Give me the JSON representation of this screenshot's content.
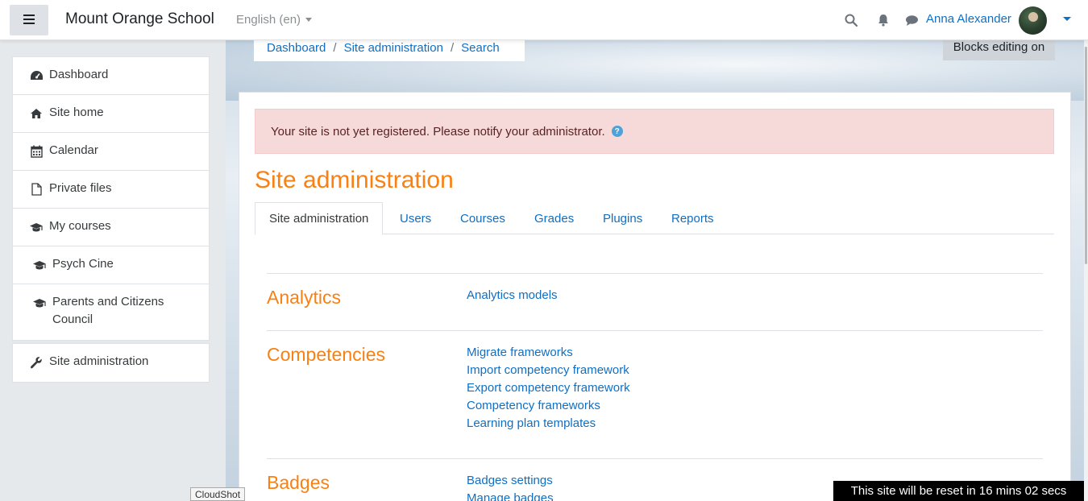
{
  "header": {
    "brand": "Mount Orange School",
    "language": "English (en)",
    "user_name": "Anna Alexander"
  },
  "icons": {
    "menu": "hamburger-icon",
    "search": "search-icon",
    "notifications": "bell-icon",
    "messages": "chat-icon"
  },
  "sidebar": {
    "items": [
      {
        "label": "Dashboard",
        "icon": "dashboard-icon"
      },
      {
        "label": "Site home",
        "icon": "home-icon"
      },
      {
        "label": "Calendar",
        "icon": "calendar-icon"
      },
      {
        "label": "Private files",
        "icon": "file-icon"
      },
      {
        "label": "My courses",
        "icon": "graduation-cap-icon"
      },
      {
        "label": "Psych Cine",
        "icon": "graduation-cap-icon"
      },
      {
        "label": "Parents and Citizens Council",
        "icon": "graduation-cap-icon"
      }
    ],
    "admin": {
      "label": "Site administration",
      "icon": "wrench-icon"
    }
  },
  "breadcrumb": [
    "Dashboard",
    "Site administration",
    "Search"
  ],
  "blocks_editing_label": "Blocks editing on",
  "alert": {
    "text": "Your site is not yet registered. Please notify your administrator.",
    "icon": "help-icon"
  },
  "page_title": "Site administration",
  "tabs": [
    "Site administration",
    "Users",
    "Courses",
    "Grades",
    "Plugins",
    "Reports"
  ],
  "sections": [
    {
      "title": "Analytics",
      "links": [
        "Analytics models"
      ]
    },
    {
      "title": "Competencies",
      "links": [
        "Migrate frameworks",
        "Import competency framework",
        "Export competency framework",
        "Competency frameworks",
        "Learning plan templates"
      ]
    },
    {
      "title": "Badges",
      "links": [
        "Badges settings",
        "Manage badges"
      ]
    }
  ],
  "reset_banner": "This site will be reset in 16 mins 02 secs",
  "cloudshot_label": "CloudShot",
  "colors": {
    "accent": "#f98012",
    "link": "#0f6fc5",
    "alert_bg": "#f6dada"
  }
}
